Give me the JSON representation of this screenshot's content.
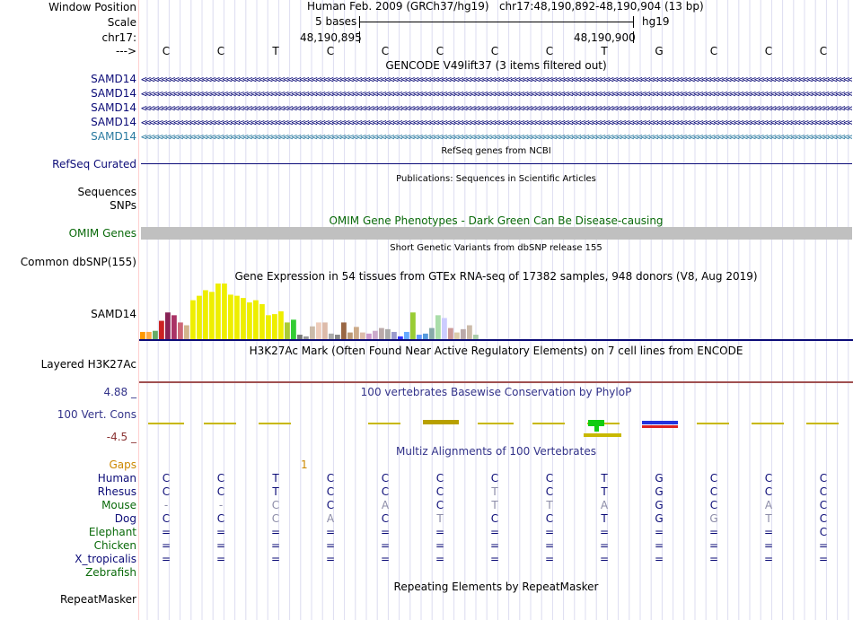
{
  "header": {
    "window_position_label": "Window Position",
    "scale_label": "Scale",
    "chrom_label": "chr17:",
    "arrow_label": "--->",
    "position_text": "Human Feb. 2009 (GRCh37/hg19)   chr17:48,190,892-48,190,904 (13 bp)",
    "scale_text": "5 bases",
    "assembly": "hg19",
    "coord_left": "48,190,895",
    "coord_right": "48,190,900",
    "sequence": [
      "C",
      "C",
      "T",
      "C",
      "C",
      "C",
      "C",
      "C",
      "T",
      "G",
      "C",
      "C",
      "C"
    ]
  },
  "tracks": {
    "gencode": {
      "title": "GENCODE V49lift37 (3 items filtered out)",
      "labels": [
        "SAMD14",
        "SAMD14",
        "SAMD14",
        "SAMD14",
        "SAMD14"
      ],
      "label_colors": [
        "#0c0c78",
        "#0c0c78",
        "#0c0c78",
        "#0c0c78",
        "#2a7aa0"
      ]
    },
    "refseq": {
      "title": "RefSeq genes from NCBI",
      "label": "RefSeq Curated"
    },
    "publications": {
      "title": "Publications: Sequences in Scientific Articles",
      "label1": "Sequences",
      "label2": "SNPs"
    },
    "omim": {
      "title": "OMIM Gene Phenotypes - Dark Green Can Be Disease-causing",
      "label": "OMIM Genes",
      "color": "#0a6a0a"
    },
    "dbsnp": {
      "title": "Short Genetic Variants from dbSNP release 155",
      "label": "Common dbSNP(155)"
    },
    "gtex": {
      "title": "Gene Expression in 54 tissues from GTEx RNA-seq of 17382 samples, 948 donors (V8, Aug 2019)",
      "label": "SAMD14"
    },
    "h3k27ac": {
      "title": "H3K27Ac Mark (Often Found Near Active Regulatory Elements) on 7 cell lines from ENCODE",
      "label": "Layered H3K27Ac"
    },
    "cons": {
      "title": "100 vertebrates Basewise Conservation by PhyloP",
      "label": "100 Vert. Cons",
      "max": "4.88 _",
      "min": "-4.5 _"
    },
    "multiz": {
      "title": "Multiz Alignments of 100 Vertebrates",
      "gaps_label": "Gaps",
      "gaps_value": "1",
      "species": [
        {
          "name": "Human",
          "bases": [
            "C",
            "C",
            "T",
            "C",
            "C",
            "C",
            "C",
            "C",
            "T",
            "G",
            "C",
            "C",
            "C"
          ]
        },
        {
          "name": "Rhesus",
          "bases": [
            "C",
            "C",
            "T",
            "C",
            "C",
            "C",
            "T",
            "C",
            "T",
            "G",
            "C",
            "C",
            "C"
          ]
        },
        {
          "name": "Mouse",
          "bases": [
            "-",
            "-",
            "C",
            "C",
            "A",
            "C",
            "T",
            "T",
            "A",
            "G",
            "C",
            "A",
            "C"
          ]
        },
        {
          "name": "Dog",
          "bases": [
            "C",
            "C",
            "C",
            "A",
            "C",
            "T",
            "C",
            "C",
            "T",
            "G",
            "G",
            "T",
            "C"
          ]
        },
        {
          "name": "Elephant",
          "bases": [
            "=",
            "=",
            "=",
            "=",
            "=",
            "=",
            "=",
            "=",
            "=",
            "=",
            "=",
            "=",
            "C"
          ]
        },
        {
          "name": "Chicken",
          "bases": [
            "=",
            "=",
            "=",
            "=",
            "=",
            "=",
            "=",
            "=",
            "=",
            "=",
            "=",
            "=",
            "="
          ]
        },
        {
          "name": "X_tropicalis",
          "bases": [
            "=",
            "=",
            "=",
            "=",
            "=",
            "=",
            "=",
            "=",
            "=",
            "=",
            "=",
            "=",
            "="
          ]
        },
        {
          "name": "Zebrafish",
          "bases": [
            "",
            "",
            "",
            "",
            "",
            "",
            "",
            "",
            "",
            "",
            "",
            "",
            ""
          ]
        }
      ]
    },
    "rmsk": {
      "title": "Repeating Elements by RepeatMasker",
      "label": "RepeatMasker"
    }
  },
  "gtex_values": [
    {
      "v": 0.13,
      "c": "#ff9900"
    },
    {
      "v": 0.13,
      "c": "#ffaa44"
    },
    {
      "v": 0.15,
      "c": "#66aa66"
    },
    {
      "v": 0.33,
      "c": "#cc2222"
    },
    {
      "v": 0.48,
      "c": "#882255"
    },
    {
      "v": 0.43,
      "c": "#aa3366"
    },
    {
      "v": 0.3,
      "c": "#cc6677"
    },
    {
      "v": 0.25,
      "c": "#d2b48c"
    },
    {
      "v": 0.7,
      "c": "#eeee00"
    },
    {
      "v": 0.78,
      "c": "#eeee00"
    },
    {
      "v": 0.88,
      "c": "#eeee00"
    },
    {
      "v": 0.85,
      "c": "#eeee00"
    },
    {
      "v": 1.0,
      "c": "#eeee00"
    },
    {
      "v": 1.0,
      "c": "#eeee00"
    },
    {
      "v": 0.8,
      "c": "#eeee00"
    },
    {
      "v": 0.78,
      "c": "#eeee00"
    },
    {
      "v": 0.74,
      "c": "#eeee00"
    },
    {
      "v": 0.66,
      "c": "#eeee00"
    },
    {
      "v": 0.7,
      "c": "#eeee00"
    },
    {
      "v": 0.63,
      "c": "#eeee00"
    },
    {
      "v": 0.43,
      "c": "#eeee00"
    },
    {
      "v": 0.45,
      "c": "#eeee00"
    },
    {
      "v": 0.5,
      "c": "#eeee00"
    },
    {
      "v": 0.3,
      "c": "#aacc33"
    },
    {
      "v": 0.35,
      "c": "#33cc33"
    },
    {
      "v": 0.08,
      "c": "#777777"
    },
    {
      "v": 0.05,
      "c": "#999999"
    },
    {
      "v": 0.23,
      "c": "#ccbbaa"
    },
    {
      "v": 0.3,
      "c": "#eeccbb"
    },
    {
      "v": 0.3,
      "c": "#ddbbaa"
    },
    {
      "v": 0.1,
      "c": "#aaaaaa"
    },
    {
      "v": 0.08,
      "c": "#888888"
    },
    {
      "v": 0.3,
      "c": "#996644"
    },
    {
      "v": 0.12,
      "c": "#bb9977"
    },
    {
      "v": 0.22,
      "c": "#ccaa88"
    },
    {
      "v": 0.12,
      "c": "#ddbbaa"
    },
    {
      "v": 0.1,
      "c": "#cc99cc"
    },
    {
      "v": 0.15,
      "c": "#ccaacc"
    },
    {
      "v": 0.2,
      "c": "#bbaaaa"
    },
    {
      "v": 0.18,
      "c": "#aaaaaa"
    },
    {
      "v": 0.13,
      "c": "#9999cc"
    },
    {
      "v": 0.05,
      "c": "#3333ff"
    },
    {
      "v": 0.13,
      "c": "#66aaff"
    },
    {
      "v": 0.48,
      "c": "#99cc33"
    },
    {
      "v": 0.08,
      "c": "#6699ff"
    },
    {
      "v": 0.1,
      "c": "#5599dd"
    },
    {
      "v": 0.2,
      "c": "#88aaaa"
    },
    {
      "v": 0.43,
      "c": "#aaddaa"
    },
    {
      "v": 0.38,
      "c": "#ccccff"
    },
    {
      "v": 0.2,
      "c": "#cc9999"
    },
    {
      "v": 0.12,
      "c": "#ddccaa"
    },
    {
      "v": 0.18,
      "c": "#bbaaaa"
    },
    {
      "v": 0.25,
      "c": "#ccbbaa"
    },
    {
      "v": 0.08,
      "c": "#aaccaa"
    }
  ]
}
